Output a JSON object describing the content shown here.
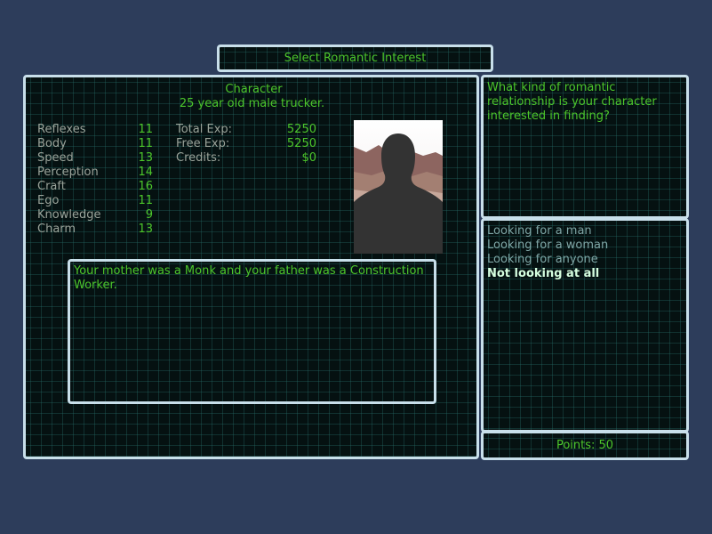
{
  "title": "Select Romantic Interest",
  "character": {
    "heading": "Character",
    "description": "25 year old male trucker.",
    "stats": [
      {
        "name": "Reflexes",
        "value": "11"
      },
      {
        "name": "Body",
        "value": "11"
      },
      {
        "name": "Speed",
        "value": "13"
      },
      {
        "name": "Perception",
        "value": "14"
      },
      {
        "name": "Craft",
        "value": "16"
      },
      {
        "name": "Ego",
        "value": "11"
      },
      {
        "name": "Knowledge",
        "value": "9"
      },
      {
        "name": "Charm",
        "value": "13"
      }
    ],
    "info": [
      {
        "name": "Total Exp:",
        "value": "5250"
      },
      {
        "name": "Free Exp:",
        "value": "5250"
      },
      {
        "name": "Credits:",
        "value": "$0"
      }
    ],
    "bio": "Your mother was a Monk and your father was a Construction Worker."
  },
  "question": "What kind of romantic relationship is your character interested in finding?",
  "options": [
    {
      "label": "Looking for a man"
    },
    {
      "label": "Looking for a woman"
    },
    {
      "label": "Looking for anyone"
    },
    {
      "label": "Not looking at all"
    }
  ],
  "selected_option_index": 3,
  "points": "Points: 50",
  "colors": {
    "background": "#2d3d5b",
    "panel": "#051111",
    "border": "#c8dfea",
    "text_green": "#4cc62b",
    "text_gray": "#9aa39a",
    "text_selected": "#d6ffe0",
    "text_option": "#7fa6a6"
  }
}
